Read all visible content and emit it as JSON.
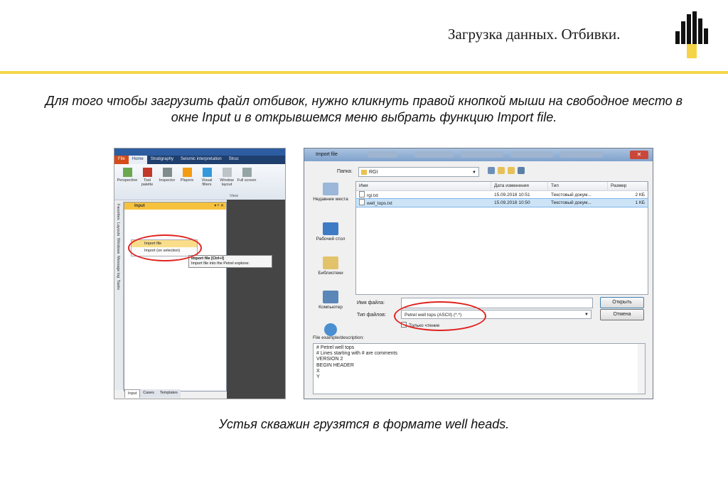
{
  "slide": {
    "title": "Загрузка данных. Отбивки.",
    "caption_1": "Для того чтобы загрузить файл отбивок, нужно кликнуть правой кнопкой мыши на свободное место в окне Input и в открывшемся меню выбрать функцию Import file.",
    "caption_2": "Устья скважин грузятся в формате well heads.",
    "accent_color": "#f5d547",
    "highlight_color": "#e0221e"
  },
  "petrel": {
    "tabs": [
      "File",
      "Home",
      "Stratigraphy",
      "Seismic interpretation",
      "Struc"
    ],
    "ribbon_buttons": [
      "Perspective",
      "Tool palette",
      "Inspector",
      "Players",
      "Visual filters",
      "Window layout",
      "Full screen"
    ],
    "group_label": "View",
    "side_tabs": [
      "Favorites",
      "Layouts",
      "Windows",
      "Message log",
      "Tasks"
    ],
    "panel_title": "Input",
    "panel_controls": "▾ ᵖ ✕",
    "context_menu": [
      "Import file",
      "Import (on selection)"
    ],
    "tooltip_title": "Import file [Ctrl+I]",
    "tooltip_text": "Import file into the Petrel explorer.",
    "bottom_tabs": [
      "Input",
      "Cases",
      "Templates"
    ]
  },
  "dialog": {
    "title": "Import file",
    "close": "✕",
    "look_in_label": "Папка:",
    "look_in_value": "RGI",
    "places": [
      "Недавние места",
      "Рабочий стол",
      "Библиотеки",
      "Компьютер",
      "File example/description:"
    ],
    "columns": [
      "Имя",
      "Дата изменения",
      "Тип",
      "Размер"
    ],
    "files": [
      {
        "name": "rgi.txt",
        "date": "15.09.2018 10:51",
        "type": "Текстовый докум...",
        "size": "2 КБ"
      },
      {
        "name": "well_tops.txt",
        "date": "15.09.2018 10:50",
        "type": "Текстовый докум...",
        "size": "1 КБ"
      }
    ],
    "filename_label": "Имя файла:",
    "filetype_label": "Тип файлов:",
    "filetype_value": "Petrel well tops (ASCII) (*.*)",
    "readonly_label": "Только чтение",
    "open_button": "Открыть",
    "cancel_button": "Отмена",
    "description_lines": [
      "# Petrel well tops",
      "# Lines starting with # are comments",
      "VERSION 2",
      "BEGIN HEADER",
      "X",
      "Y"
    ]
  }
}
